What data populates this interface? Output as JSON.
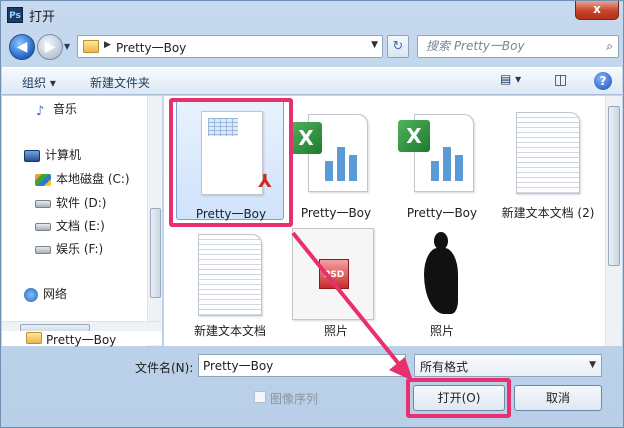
{
  "window": {
    "title": "打开",
    "app_icon_text": "Ps",
    "close_glyph": "x"
  },
  "nav": {
    "back_glyph": "◀",
    "forward_glyph": "▶",
    "history_glyph": "▼",
    "crumb_arrow": "▶",
    "breadcrumb": "Pretty一Boy",
    "address_dropdown_glyph": "▼",
    "refresh_glyph": "↻",
    "search_placeholder": "搜索 Pretty一Boy",
    "search_glyph": "⌕"
  },
  "toolbar": {
    "organize_label": "组织 ▾",
    "new_folder_label": "新建文件夹",
    "view_glyph": "▤ ▾",
    "pane_glyph": "◫",
    "help_glyph": "?"
  },
  "sidebar": {
    "music": "音乐",
    "computer": "计算机",
    "drive_c": "本地磁盘 (C:)",
    "drive_d": "软件 (D:)",
    "drive_e": "文档 (E:)",
    "drive_f": "娱乐 (F:)",
    "network": "网络",
    "folder": "Pretty一Boy"
  },
  "files": [
    {
      "name": "Pretty一Boy",
      "kind": "pdf",
      "selected": true
    },
    {
      "name": "Pretty一Boy",
      "kind": "excel"
    },
    {
      "name": "Pretty一Boy",
      "kind": "excel"
    },
    {
      "name": "新建文本文档 (2)",
      "kind": "text"
    },
    {
      "name": "新建文本文档",
      "kind": "text"
    },
    {
      "name": "照片",
      "kind": "psd"
    },
    {
      "name": "照片",
      "kind": "photo"
    }
  ],
  "bottom": {
    "filename_label": "文件名(N):",
    "filename_value": "Pretty一Boy",
    "format_value": "所有格式",
    "format_dropdown_glyph": "▼",
    "sequence_label": "图像序列",
    "open_button": "打开(O)",
    "cancel_button": "取消"
  },
  "colors": {
    "highlight": "#e8306f",
    "selection": "#cfe3fb",
    "accent": "#1f62c7"
  }
}
